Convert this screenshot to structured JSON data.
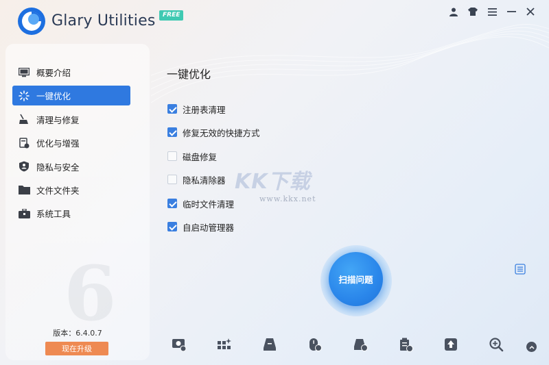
{
  "app": {
    "title": "Glary Utilities",
    "badge": "FREE"
  },
  "window_controls": [
    "user-icon",
    "skin-icon",
    "menu-icon",
    "minimize-icon",
    "close-icon"
  ],
  "sidebar": {
    "items": [
      {
        "label": "概要介绍",
        "icon": "monitor-icon",
        "active": false
      },
      {
        "label": "一键优化",
        "icon": "sparkle-icon",
        "active": true
      },
      {
        "label": "清理与修复",
        "icon": "broom-icon",
        "active": false
      },
      {
        "label": "优化与增强",
        "icon": "speed-icon",
        "active": false
      },
      {
        "label": "隐私与安全",
        "icon": "shield-user-icon",
        "active": false
      },
      {
        "label": "文件文件夹",
        "icon": "folder-icon",
        "active": false
      },
      {
        "label": "系统工具",
        "icon": "toolbox-icon",
        "active": false
      }
    ],
    "version_label": "版本：",
    "version": "6.4.0.7",
    "upgrade_label": "现在升级"
  },
  "main": {
    "title": "一键优化",
    "options": [
      {
        "label": "注册表清理",
        "checked": true
      },
      {
        "label": "修复无效的快捷方式",
        "checked": true
      },
      {
        "label": "磁盘修复",
        "checked": false
      },
      {
        "label": "隐私清除器",
        "checked": false
      },
      {
        "label": "临时文件清理",
        "checked": true
      },
      {
        "label": "自启动管理器",
        "checked": true
      }
    ],
    "scan_button": "扫描问题"
  },
  "watermark": {
    "text": "KK下载",
    "url": "www.kkx.net"
  },
  "toolbar": {
    "icons": [
      "disk-clean-icon",
      "startup-manager-icon",
      "disk-analysis-icon",
      "memory-optimizer-icon",
      "disk-repair-icon",
      "uninstall-icon",
      "update-icon",
      "search-icon"
    ]
  },
  "colors": {
    "accent": "#2f79e0",
    "upgrade": "#ee8a52",
    "badge": "#3fc9b2"
  }
}
